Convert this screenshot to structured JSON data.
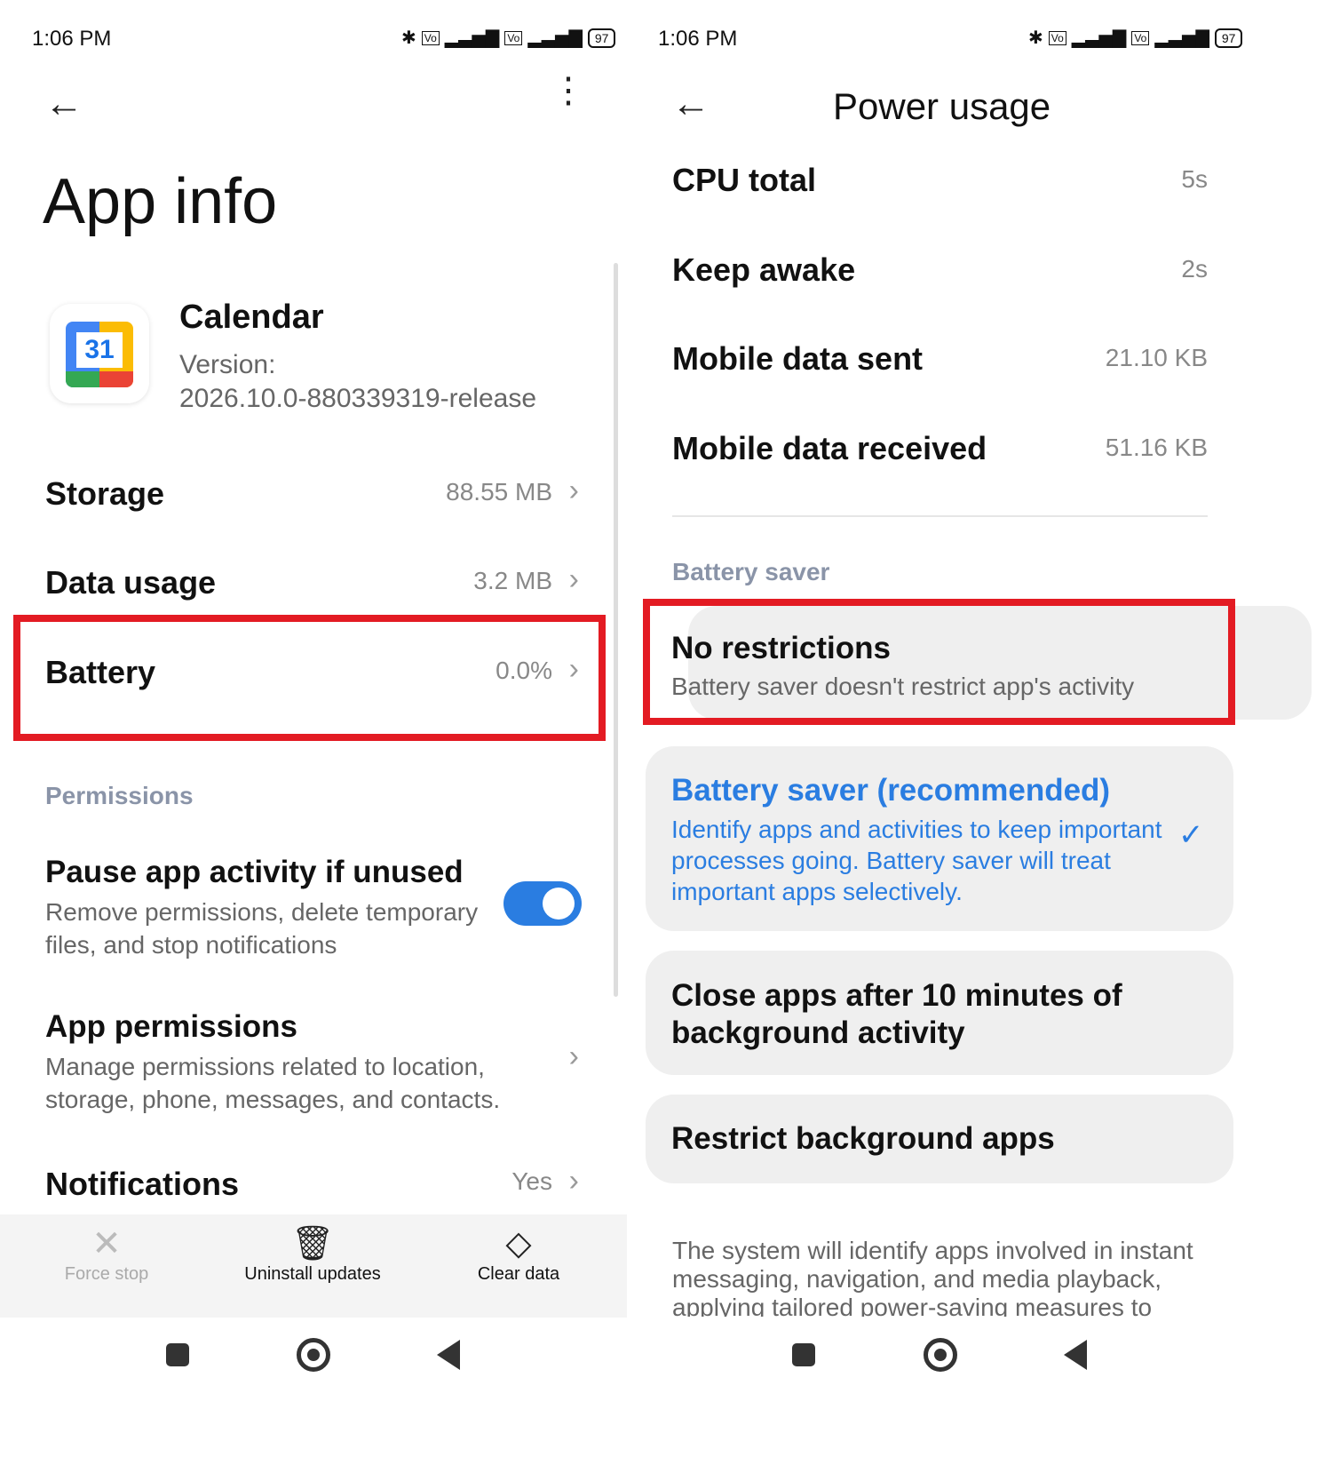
{
  "status_bar": {
    "time": "1:06 PM",
    "battery": "97"
  },
  "app_info": {
    "title": "App info",
    "app_name": "Calendar",
    "app_icon_text": "31",
    "version_label": "Version:",
    "version_value": "2026.10.0-880339319-release",
    "rows": [
      {
        "label": "Storage",
        "value": "88.55 MB"
      },
      {
        "label": "Data usage",
        "value": "3.2 MB"
      },
      {
        "label": "Battery",
        "value": "0.0%"
      }
    ],
    "permissions_header": "Permissions",
    "pause_title": "Pause app activity if unused",
    "pause_desc": "Remove permissions, delete temporary files, and stop notifications",
    "pause_toggle_on": true,
    "app_permissions_title": "App permissions",
    "app_permissions_desc": "Manage permissions related to location, storage, phone, messages, and contacts.",
    "notifications_label": "Notifications",
    "notifications_value": "Yes",
    "actions": [
      {
        "label": "Force stop",
        "icon": "close-x-icon"
      },
      {
        "label": "Uninstall updates",
        "icon": "trash-icon"
      },
      {
        "label": "Clear data",
        "icon": "eraser-icon"
      }
    ]
  },
  "power_usage": {
    "title": "Power usage",
    "stats": [
      {
        "label": "CPU total",
        "value": "5s"
      },
      {
        "label": "Keep awake",
        "value": "2s"
      },
      {
        "label": "Mobile data sent",
        "value": "21.10 KB"
      },
      {
        "label": "Mobile data received",
        "value": "51.16 KB"
      }
    ],
    "section": "Battery saver",
    "options": [
      {
        "title": "No restrictions",
        "desc": "Battery saver doesn't restrict app's activity"
      },
      {
        "title": "Battery saver (recommended)",
        "desc": "Identify apps and activities to keep important processes going. Battery saver will treat important apps selectively."
      },
      {
        "title": "Close apps after 10 minutes of background activity"
      },
      {
        "title": "Restrict background apps"
      }
    ],
    "footer": "The system will identify apps involved in instant messaging, navigation, and media playback, applying tailored power-saving measures to"
  },
  "colors": {
    "accent": "#2a7de1",
    "highlight": "#e31b23",
    "toggle": "#2a7de1",
    "card": "#efefef"
  }
}
